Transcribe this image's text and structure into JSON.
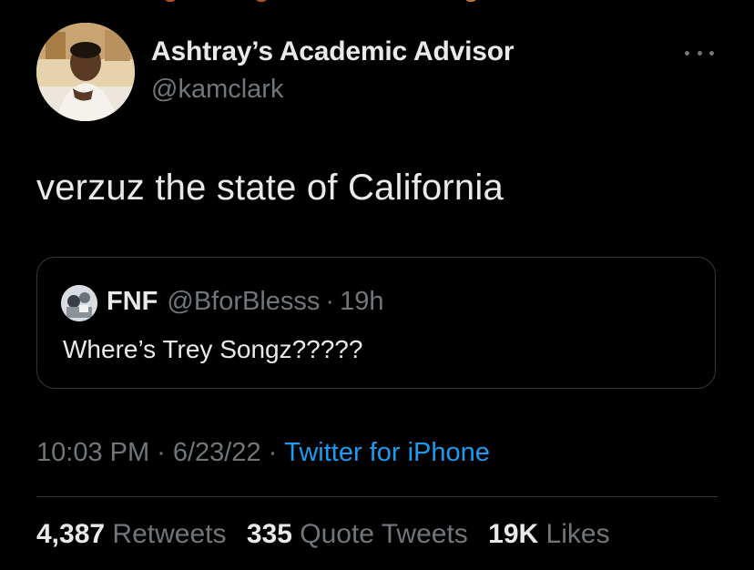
{
  "author": {
    "display_name": "Ashtray’s Academic Advisor",
    "handle": "@kamclark"
  },
  "tweet": {
    "text": "verzuz the state of California"
  },
  "quoted_tweet": {
    "display_name": "FNF",
    "handle": "@BforBlesss",
    "separator": "·",
    "time": "19h",
    "text": "Where’s Trey Songz?????"
  },
  "meta": {
    "time": "10:03 PM",
    "separator": "·",
    "date": "6/23/22",
    "source": "Twitter for iPhone"
  },
  "stats": {
    "retweets_count": "4,387",
    "retweets_label": "Retweets",
    "quotes_count": "335",
    "quotes_label": "Quote Tweets",
    "likes_count": "19K",
    "likes_label": "Likes"
  },
  "colors": {
    "background": "#000000",
    "primary_text": "#e7e9ea",
    "secondary_text": "#71767b",
    "link": "#1d9bf0",
    "border": "#333639"
  },
  "icons": {
    "more": "more-horizontal-icon"
  }
}
